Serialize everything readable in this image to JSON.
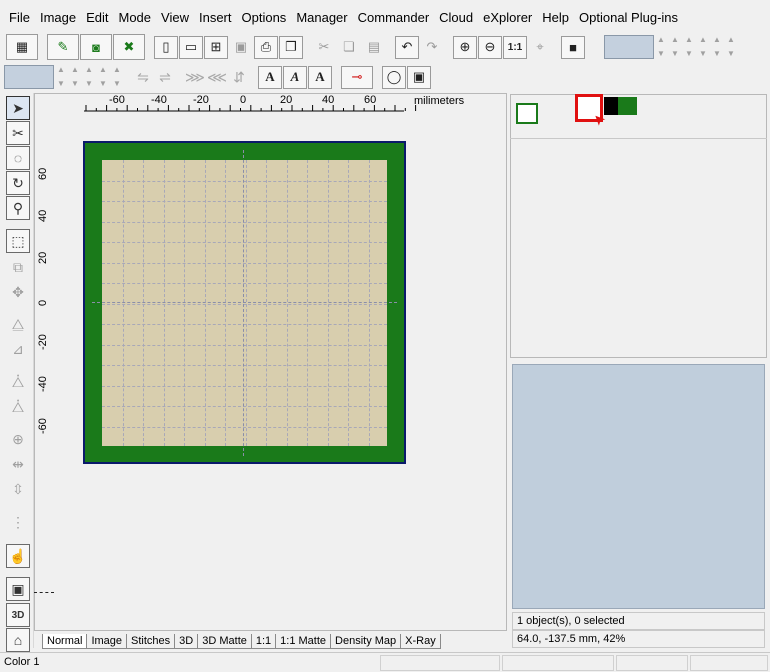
{
  "menu": [
    "File",
    "Image",
    "Edit",
    "Mode",
    "View",
    "Insert",
    "Options",
    "Manager",
    "Commander",
    "Cloud",
    "eXplorer",
    "Help",
    "Optional Plug-ins"
  ],
  "toolbar1": {
    "icons": [
      "frame-icon",
      "stitch-edit-icon",
      "camera-icon",
      "cross-stitch-icon",
      "new-file-icon",
      "open-file-icon",
      "add-file-icon",
      "save-icon",
      "print-icon",
      "print-preview-icon",
      "cut-icon",
      "copy-icon",
      "paste-icon",
      "undo-icon",
      "redo-icon",
      "zoom-in-icon",
      "zoom-out-icon",
      "zoom-1-1-icon",
      "zoom-fit-icon",
      "stop-icon"
    ],
    "zoom_11_label": "1:1"
  },
  "toolbar2": {
    "text_tools": [
      "A",
      "A",
      "A"
    ]
  },
  "ruler": {
    "unit_label": "milimeters",
    "h_ticks": [
      "-60",
      "-40",
      "-20",
      "0",
      "20",
      "40",
      "60"
    ],
    "v_ticks": [
      "60",
      "40",
      "20",
      "0",
      "-20",
      "-40",
      "-60"
    ]
  },
  "tabs": [
    "Normal",
    "Image",
    "Stitches",
    "3D",
    "3D Matte",
    "1:1",
    "1:1 Matte",
    "Density Map",
    "X-Ray"
  ],
  "active_tab": "Normal",
  "right_panel": {
    "selection_status": "1 object(s), 0 selected",
    "coords_status": "64.0, -137.5 mm, 42%"
  },
  "colors": {
    "thread_green": "#1a7a1a",
    "thread_black": "#000000",
    "thread_white": "#ffffff",
    "fabric": "#d8ceae",
    "frame": "#0a1a6a",
    "selection_red": "#e01010"
  },
  "statusbar": {
    "left": "Color 1"
  },
  "tools_left": {
    "button_3d": "3D"
  }
}
